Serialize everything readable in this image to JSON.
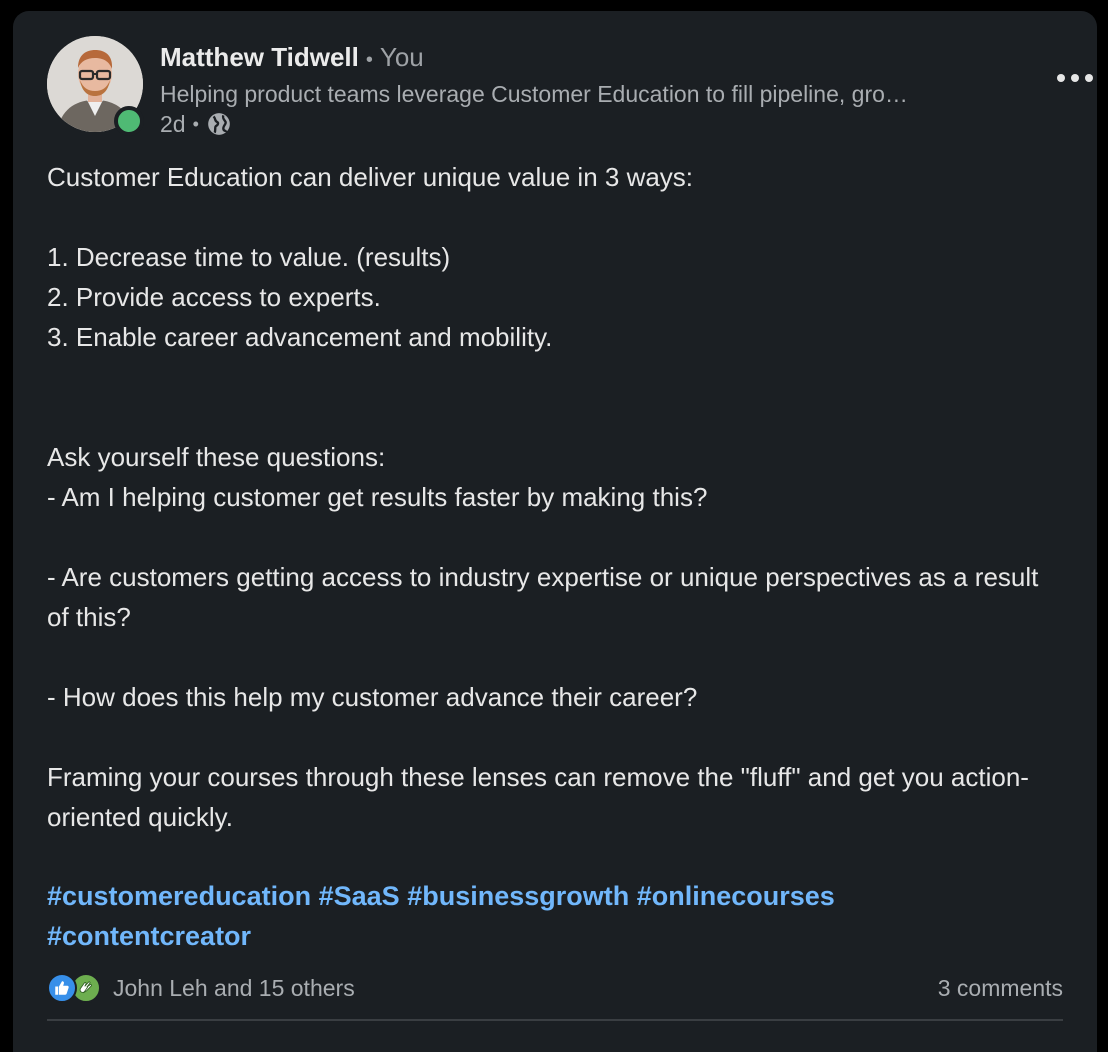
{
  "post": {
    "author": {
      "name": "Matthew Tidwell",
      "degree": "You",
      "headline": "Helping product teams leverage Customer Education to fill pipeline, gro…",
      "time": "2d",
      "visibility_icon": "globe-icon",
      "presence_status_color": "#4fba74"
    },
    "menu_icon": "more-horizontal-icon",
    "body_lines": [
      "Customer Education can deliver unique value in 3 ways:",
      "",
      "1. Decrease time to value. (results)",
      "2. Provide access to experts.",
      "3. Enable career advancement and mobility.",
      "",
      "",
      "Ask yourself these questions:",
      "- Am I helping customer get results faster by making this?",
      "",
      "- Are customers getting access to industry expertise or unique perspectives as a result of this?",
      "",
      "- How does this help my customer advance their career?",
      "",
      "Framing your courses through these lenses can remove the \"fluff\" and get you action-oriented quickly."
    ],
    "hashtags": [
      "#customereducation",
      "#SaaS",
      "#businessgrowth",
      "#onlinecourses",
      "#contentcreator"
    ],
    "social": {
      "reaction_icons": [
        "like-icon",
        "celebrate-icon"
      ],
      "reactions_text": "John Leh and 15 others",
      "comments_text": "3 comments"
    },
    "colors": {
      "card_background": "#1b1f23",
      "hashtag": "#71b7fb",
      "secondary_text": "#a9adb1"
    }
  }
}
